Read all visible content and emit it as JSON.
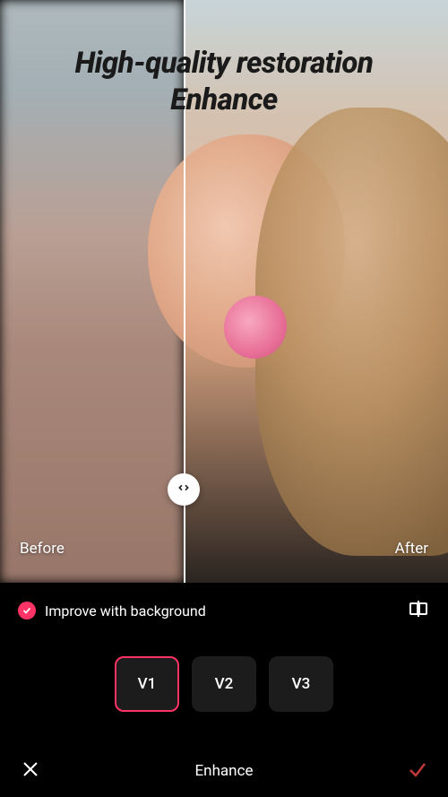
{
  "header": {
    "title_line1": "High-quality restoration",
    "title_line2": "Enhance"
  },
  "preview": {
    "before_label": "Before",
    "after_label": "After",
    "slider_position_pct": 41
  },
  "toggle": {
    "label": "Improve with background",
    "checked": true
  },
  "versions": {
    "options": [
      {
        "label": "V1",
        "selected": true
      },
      {
        "label": "V2",
        "selected": false
      },
      {
        "label": "V3",
        "selected": false
      }
    ]
  },
  "footer": {
    "title": "Enhance"
  },
  "colors": {
    "accent": "#ff3366",
    "confirm": "#c23a3a"
  }
}
